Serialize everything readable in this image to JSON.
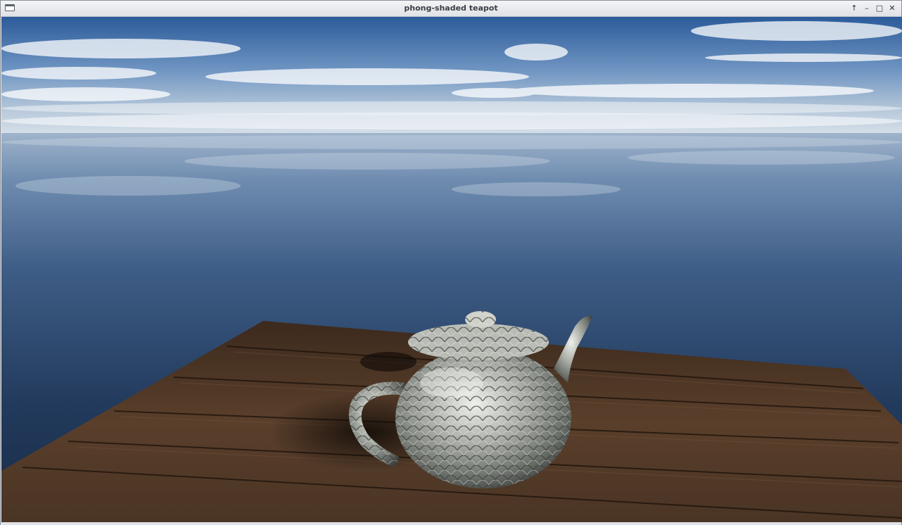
{
  "window": {
    "title": "phong-shaded teapot",
    "buttons": {
      "keep_above": "↑",
      "minimize": "–",
      "maximize": "□",
      "close": "✕"
    }
  },
  "icons": {
    "window_menu": "window-menu-icon",
    "keep_above": "arrow-up-icon",
    "minimize": "minimize-icon",
    "maximize": "maximize-icon",
    "close": "close-icon"
  },
  "scene": {
    "description": "3D render: metallic scaled teapot on wooden planks over reflective ocean under cloudy sky",
    "colors": {
      "sky_top": "#2f5e9c",
      "sky_horizon": "#c9d6e2",
      "sea_far": "#6f8fb3",
      "sea_near": "#1d3352",
      "wood": "#4a3322",
      "wood_light": "#6b4a32",
      "teapot": "#c9ccc4"
    }
  }
}
